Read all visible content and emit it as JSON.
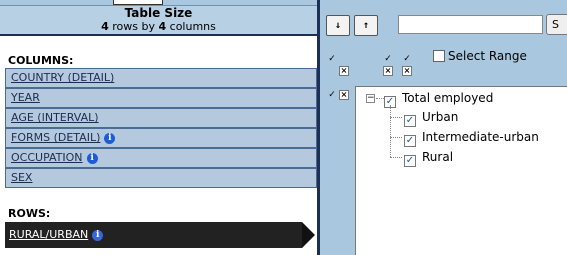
{
  "table_size": {
    "title": "Table Size",
    "rows_count": "4",
    "rows_word": "rows by",
    "cols_count": "4",
    "cols_word": "columns"
  },
  "columns": {
    "label": "COLUMNS:",
    "items": [
      {
        "label": "COUNTRY (DETAIL)",
        "info": false
      },
      {
        "label": "YEAR",
        "info": false
      },
      {
        "label": "AGE (INTERVAL)",
        "info": false
      },
      {
        "label": "FORMS (DETAIL)",
        "info": true
      },
      {
        "label": "OCCUPATION",
        "info": true
      },
      {
        "label": "SEX",
        "info": false
      }
    ]
  },
  "rows": {
    "label": "ROWS:",
    "items": [
      {
        "label": "RURAL/URBAN",
        "info": true
      }
    ]
  },
  "toolbar": {
    "sort_asc_label": "↓",
    "sort_desc_label": "↑",
    "search_placeholder": "",
    "search_button_label": "S"
  },
  "select_range": {
    "label": "Select Range",
    "checked": false
  },
  "tree": {
    "root": {
      "label": "Total employed",
      "checked": true,
      "expander": "−"
    },
    "children": [
      {
        "label": "Urban",
        "checked": true
      },
      {
        "label": "Intermediate-urban",
        "checked": true
      },
      {
        "label": "Rural",
        "checked": true
      }
    ]
  },
  "icons": {
    "info": "i",
    "check": "✓",
    "cross": "×"
  },
  "colors": {
    "panel_blue": "#a9c7df",
    "dark_navy": "#1d2f55",
    "info_blue": "#1e5bd6"
  }
}
